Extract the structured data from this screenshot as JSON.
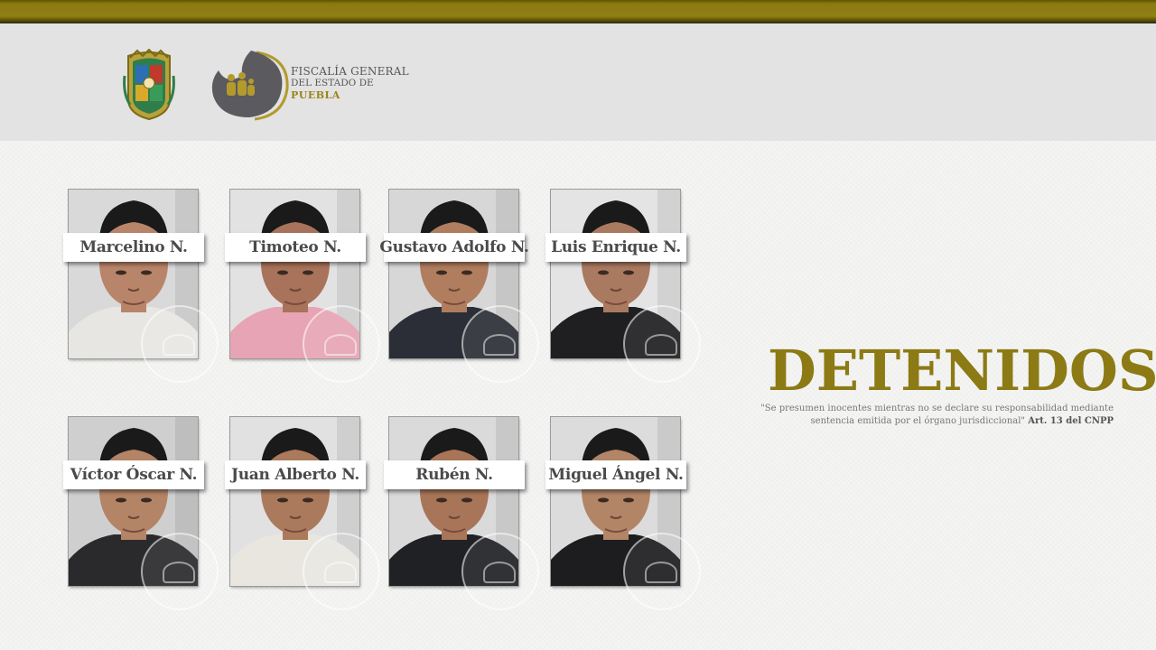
{
  "header": {
    "org_line1": "FISCALÍA GENERAL",
    "org_line2": "DEL ESTADO DE",
    "org_line3": "PUEBLA"
  },
  "detainees": [
    {
      "name": "Marcelino N."
    },
    {
      "name": "Timoteo N."
    },
    {
      "name": "Gustavo Adolfo N."
    },
    {
      "name": "Luis Enrique N."
    },
    {
      "name": "Víctor Óscar N."
    },
    {
      "name": "Juan Alberto N."
    },
    {
      "name": "Rubén N."
    },
    {
      "name": "Miguel Ángel N."
    }
  ],
  "main": {
    "title": "DETENIDOS",
    "quote_line1": "\"Se presumen inocentes mientras no se declare su responsabilidad mediante",
    "quote_line2": "sentencia emitida por el órgano jurisdiccional\"",
    "quote_ref": "Art. 13 del CNPP"
  },
  "colors": {
    "accent_gold": "#8c7a14",
    "header_bg": "#e3e3e3",
    "name_text": "#4a4a4a"
  },
  "icons": {
    "state_shield": "puebla-coat-of-arms",
    "org_logo": "fiscalia-eagle-family-logo",
    "watermark": "fiscalia-watermark-seal"
  }
}
